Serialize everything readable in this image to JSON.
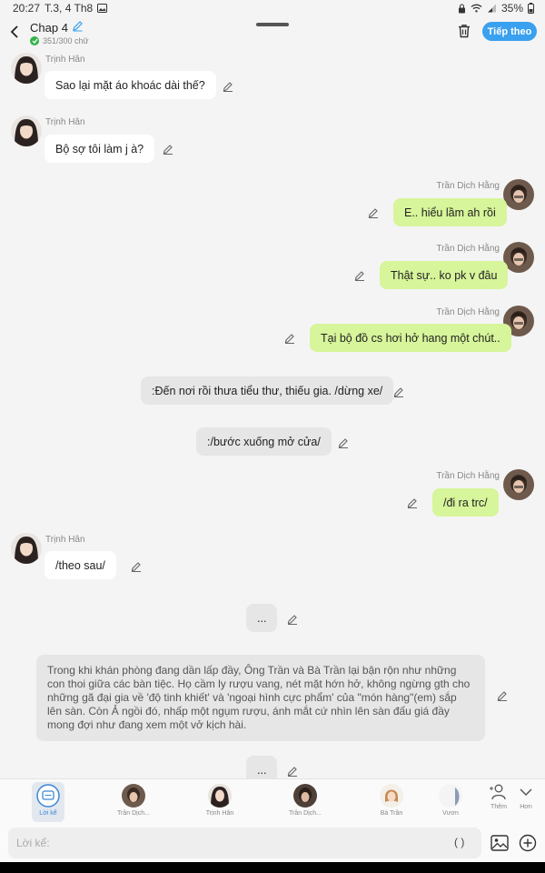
{
  "status": {
    "time": "20:27",
    "date": "T.3, 4 Th8",
    "battery": "35%"
  },
  "header": {
    "title": "Chap 4",
    "word_count": "351/300 chữ",
    "next_label": "Tiếp theo"
  },
  "messages": [
    {
      "speaker": "Trịnh Hân",
      "text": "Sao lại mặt áo khoác dài thế?"
    },
    {
      "speaker": "Trịnh Hân",
      "text": "Bộ sợ tôi làm j à?"
    },
    {
      "speaker": "Trần Dịch Hằng",
      "text": "E.. hiểu lầm ah rồi"
    },
    {
      "speaker": "Trần Dịch Hằng",
      "text": "Thật sự.. ko pk v đâu"
    },
    {
      "speaker": "Trần Dịch Hằng",
      "text": "Tại bộ đồ cs hơi hở hang một chút.."
    },
    {
      "speaker": "",
      "text": ":Đến nơi rồi thưa tiểu thư, thiếu gia. /dừng xe/"
    },
    {
      "speaker": "",
      "text": ":/bước xuống mở cửa/"
    },
    {
      "speaker": "Trần Dịch Hằng",
      "text": "/đi ra trc/"
    },
    {
      "speaker": "Trịnh Hân",
      "text": "/theo sau/"
    },
    {
      "speaker": "",
      "text": "..."
    },
    {
      "speaker": "",
      "text": "Trong khi khán phòng đang dần lấp đầy, Ông Trần và Bà Trần lại bận rộn như những con thoi giữa các bàn tiệc. Họ cầm ly rượu vang, nét mặt hớn hở, không ngừng gth cho những gã đại gia về 'độ tinh khiết' và 'ngoại hình cực phẩm' của \"món hàng\"(em) sắp lên sàn. Còn Ả ngồi đó, nhấp một ngụm rượu, ánh mắt cứ nhìn lên sàn đấu giá đầy mong đợi như đang xem một vở kịch hài."
    },
    {
      "speaker": "",
      "text": "..."
    }
  ],
  "characters": [
    {
      "label": "Lời kể",
      "icon": "chat-bubble-icon",
      "active": true
    },
    {
      "label": "Trần Dịch...",
      "icon": "avatar-tran-dich-hang"
    },
    {
      "label": "Trịnh Hân",
      "icon": "avatar-trinh-han"
    },
    {
      "label": "Trần Dịch...",
      "icon": "avatar-tran-dich"
    },
    {
      "label": "Bà Trần",
      "icon": "avatar-ba-tran"
    },
    {
      "label": "Vươn",
      "icon": "avatar-vuong"
    }
  ],
  "actions": {
    "more": "Thêm",
    "less": "Hơn"
  },
  "input": {
    "placeholder": "Lời kể:",
    "paren": "( )"
  },
  "colors": {
    "accent": "#3aa0f0",
    "green_bubble": "#d7f59a",
    "white_bubble": "#ffffff",
    "narration_bubble": "#e6e6e6"
  }
}
